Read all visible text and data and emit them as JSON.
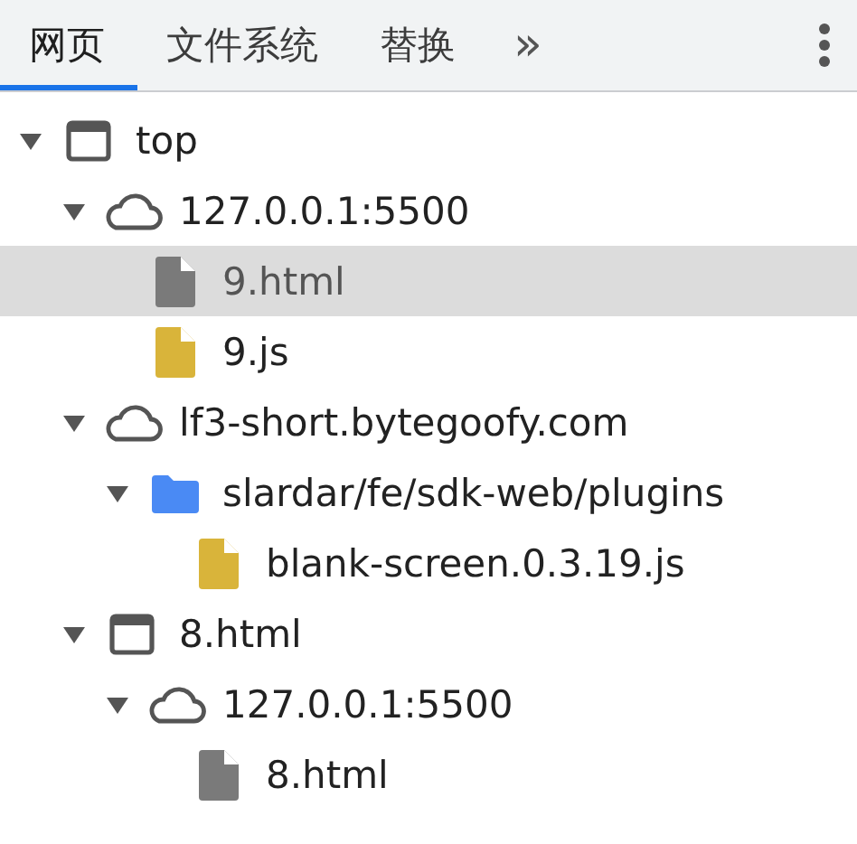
{
  "tabs": [
    {
      "label": "网页",
      "selected": true
    },
    {
      "label": "文件系统",
      "selected": false
    },
    {
      "label": "替换",
      "selected": false
    }
  ],
  "more_tabs": "»",
  "tree": [
    {
      "kind": "frame",
      "label": "top",
      "expanded": true,
      "selected": false,
      "children": [
        {
          "kind": "domain",
          "label": "127.0.0.1:5500",
          "expanded": true,
          "selected": false,
          "children": [
            {
              "kind": "document",
              "label": "9.html",
              "selected": true
            },
            {
              "kind": "script",
              "label": "9.js",
              "selected": false
            }
          ]
        },
        {
          "kind": "domain",
          "label": "lf3-short.bytegoofy.com",
          "expanded": true,
          "selected": false,
          "children": [
            {
              "kind": "folder",
              "label": "slardar/fe/sdk-web/plugins",
              "expanded": true,
              "selected": false,
              "children": [
                {
                  "kind": "script",
                  "label": "blank-screen.0.3.19.js",
                  "selected": false
                }
              ]
            }
          ]
        },
        {
          "kind": "frame",
          "label": "8.html",
          "expanded": true,
          "selected": false,
          "children": [
            {
              "kind": "domain",
              "label": "127.0.0.1:5500",
              "expanded": true,
              "selected": false,
              "children": [
                {
                  "kind": "document",
                  "label": "8.html",
                  "selected": false
                }
              ]
            }
          ]
        }
      ]
    }
  ]
}
